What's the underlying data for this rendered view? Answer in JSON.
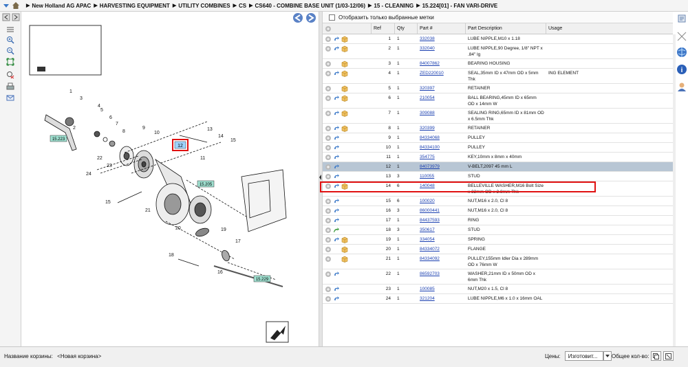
{
  "breadcrumb": [
    "New Holland AG APAC",
    "HARVESTING EQUIPMENT",
    "UTILITY COMBINES",
    "CS",
    "CS640 - COMBINE BASE UNIT (1/03-12/06)",
    "15 - CLEANING",
    "15.224[01] - FAN VARI-DRIVE"
  ],
  "filter": {
    "label": "Отобразить только выбранные метки"
  },
  "columns": {
    "ref": "Ref",
    "qty": "Qty",
    "part": "Part #",
    "desc": "Part Description",
    "usage": "Usage"
  },
  "rows": [
    {
      "ref": "1",
      "qty": "1",
      "part": "332038",
      "desc": "LUBE NIPPLE,M10 x 1.18",
      "usage": ""
    },
    {
      "ref": "2",
      "qty": "1",
      "part": "332040",
      "desc": "LUBE NIPPLE,90 Degree, 1/8\" NPT x .84\" lg",
      "usage": ""
    },
    {
      "ref": "3",
      "qty": "1",
      "part": "84007862",
      "desc": "BEARING HOUSING",
      "usage": ""
    },
    {
      "ref": "4",
      "qty": "1",
      "part": "ZED220010",
      "desc": "SEAL,35mm ID x 47mm OD x 5mm Thk",
      "usage": "ING ELEMENT"
    },
    {
      "ref": "5",
      "qty": "1",
      "part": "320397",
      "desc": "RETAINER",
      "usage": ""
    },
    {
      "ref": "6",
      "qty": "1",
      "part": "210054",
      "desc": "BALL BEARING,45mm ID x 65mm OD x 14mm W",
      "usage": ""
    },
    {
      "ref": "7",
      "qty": "1",
      "part": "309088",
      "desc": "SEALING RING,65mm ID x 81mm OD x 6.5mm Thk",
      "usage": ""
    },
    {
      "ref": "8",
      "qty": "1",
      "part": "320399",
      "desc": "RETAINER",
      "usage": ""
    },
    {
      "ref": "9",
      "qty": "1",
      "part": "84334068",
      "desc": "PULLEY",
      "usage": ""
    },
    {
      "ref": "10",
      "qty": "1",
      "part": "84334100",
      "desc": "PULLEY",
      "usage": ""
    },
    {
      "ref": "11",
      "qty": "1",
      "part": "354775",
      "desc": "KEY,10mm x 8mm x 40mm",
      "usage": ""
    },
    {
      "ref": "12",
      "qty": "1",
      "part": "84073979",
      "desc": "V-BELT,2097 45 mm L",
      "usage": ""
    },
    {
      "ref": "13",
      "qty": "3",
      "part": "110055",
      "desc": "STUD",
      "usage": ""
    },
    {
      "ref": "14",
      "qty": "6",
      "part": "140048",
      "desc": "BELLEVILLE WASHER,M16 Bolt Size x 32mm OD x 2.8mm Thk",
      "usage": ""
    },
    {
      "ref": "15",
      "qty": "6",
      "part": "100020",
      "desc": "NUT,M16 x 2.0, Cl 8",
      "usage": ""
    },
    {
      "ref": "16",
      "qty": "3",
      "part": "86000441",
      "desc": "NUT,M16 x 2.0, Cl 8",
      "usage": ""
    },
    {
      "ref": "17",
      "qty": "1",
      "part": "84437593",
      "desc": "RING",
      "usage": ""
    },
    {
      "ref": "18",
      "qty": "3",
      "part": "350617",
      "desc": "STUD",
      "usage": ""
    },
    {
      "ref": "19",
      "qty": "1",
      "part": "334054",
      "desc": "SPRING",
      "usage": ""
    },
    {
      "ref": "20",
      "qty": "1",
      "part": "84334072",
      "desc": "FLANGE",
      "usage": ""
    },
    {
      "ref": "21",
      "qty": "1",
      "part": "84334092",
      "desc": "PULLEY,155mm Idler Dia x 289mm OD x 76mm W",
      "usage": ""
    },
    {
      "ref": "22",
      "qty": "1",
      "part": "86592703",
      "desc": "WASHER,21mm ID x 50mm OD x 6mm Thk",
      "usage": ""
    },
    {
      "ref": "23",
      "qty": "1",
      "part": "100085",
      "desc": "NUT,M20 x 1.5, Cl 8",
      "usage": ""
    },
    {
      "ref": "24",
      "qty": "1",
      "part": "321204",
      "desc": "LUBE NIPPLE,M6 x 1.0 x 16mm OAL",
      "usage": ""
    }
  ],
  "diagram": {
    "callouts": [
      "1",
      "2",
      "3",
      "4",
      "5",
      "6",
      "7",
      "8",
      "9",
      "10",
      "11",
      "12",
      "13",
      "14",
      "15",
      "15",
      "16",
      "17",
      "18",
      "19",
      "20",
      "21",
      "22",
      "23",
      "24"
    ],
    "refs": [
      "15.223",
      "15.205",
      "15.229"
    ],
    "selected_callout": "12"
  },
  "bottom": {
    "basket_label": "Название корзины:",
    "basket_value": "<Новая корзина>",
    "prices_label": "Цены:",
    "prices_value": "Изготовит...",
    "total_label": "Общее кол-во:"
  },
  "colors": {
    "selected_row": "#b8c6d4",
    "highlight": "#e01010",
    "link": "#1a3fb0"
  }
}
